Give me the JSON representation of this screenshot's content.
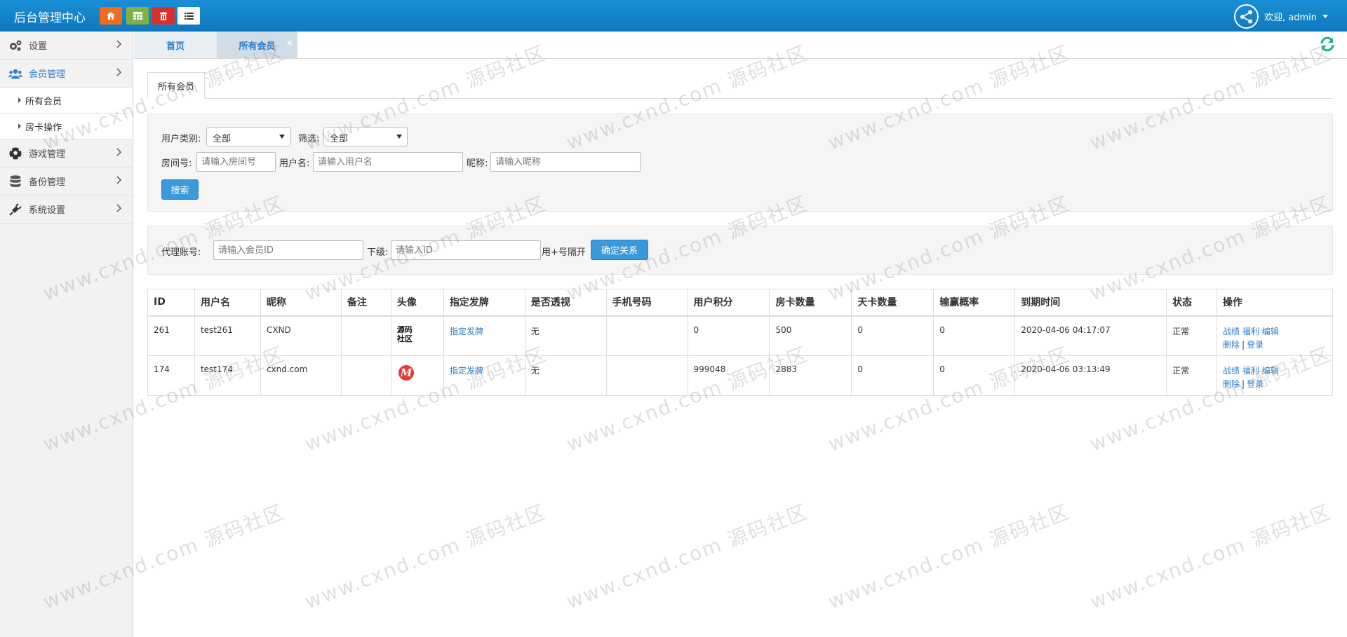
{
  "app": {
    "title": "后台管理中心"
  },
  "header": {
    "quick_buttons": [
      {
        "icon": "home-icon",
        "color": "#f06c1f"
      },
      {
        "icon": "table-icon",
        "color": "#7cb342"
      },
      {
        "icon": "trash-icon",
        "color": "#d9302c"
      },
      {
        "icon": "list-icon",
        "color": "#ffffff"
      }
    ],
    "welcome": "欢迎, admin",
    "user_icon": "share-network-icon"
  },
  "sidebar": {
    "items": [
      {
        "label": "设置",
        "icon": "gears-icon"
      },
      {
        "label": "会员管理",
        "icon": "users-icon",
        "active": true
      },
      {
        "label": "所有会员"
      },
      {
        "label": "房卡操作"
      },
      {
        "label": "游戏管理",
        "icon": "soccer-ball-icon"
      },
      {
        "label": "备份管理",
        "icon": "database-icon"
      },
      {
        "label": "系统设置",
        "icon": "plug-icon"
      }
    ]
  },
  "tabs": [
    {
      "label": "首页"
    },
    {
      "label": "所有会员",
      "close": "×"
    }
  ],
  "content": {
    "subtab": "所有会员",
    "search": {
      "user_type_label": "用户类别:",
      "user_type_value": "全部",
      "filter_label": "筛选:",
      "filter_value": "全部",
      "room_label": "房间号:",
      "room_placeholder": "请输入房间号",
      "username_label": "用户名:",
      "username_placeholder": "请输入用户名",
      "nickname_label": "昵称:",
      "nickname_placeholder": "请输入昵称",
      "search_button": "搜索"
    },
    "agent": {
      "agent_label": "代理账号:",
      "agent_placeholder": "请输入会员ID",
      "sub_label": "下级:",
      "sub_placeholder": "请输入ID",
      "hint": "用+号隔开",
      "confirm_button": "确定关系"
    },
    "table": {
      "columns": [
        "ID",
        "用户名",
        "昵称",
        "备注",
        "头像",
        "指定发牌",
        "是否透视",
        "手机号码",
        "用户积分",
        "房卡数量",
        "天卡数量",
        "输赢概率",
        "到期时间",
        "状态",
        "操作"
      ],
      "rows": [
        {
          "id": "261",
          "username": "test261",
          "nickname": "CXND",
          "note": "",
          "avatar": "源码社区",
          "deal": "指定发牌",
          "xray": "无",
          "phone": "",
          "points": "0",
          "room_cards": "500",
          "day_cards": "0",
          "win_rate": "0",
          "expire": "2020-04-06 04:17:07",
          "status": "正常",
          "actions": [
            "战绩",
            "福利",
            "编辑",
            "删除",
            "登录"
          ],
          "sep": "|"
        },
        {
          "id": "174",
          "username": "test174",
          "nickname": "cxnd.com",
          "note": "",
          "avatar": "M",
          "deal": "指定发牌",
          "xray": "无",
          "phone": "",
          "points": "999048",
          "room_cards": "2883",
          "day_cards": "0",
          "win_rate": "0",
          "expire": "2020-04-06 03:13:49",
          "status": "正常",
          "actions": [
            "战绩",
            "福利",
            "编辑",
            "删除",
            "登录"
          ],
          "sep": "|"
        }
      ]
    }
  },
  "watermark": {
    "text": "www.cxnd.com 源码社区"
  }
}
